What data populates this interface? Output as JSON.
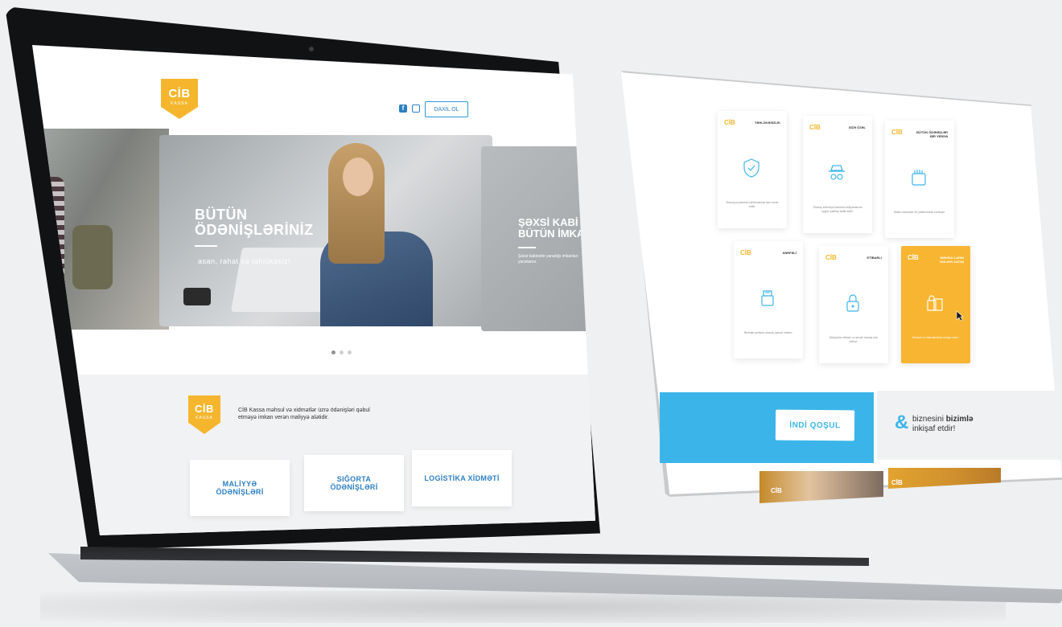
{
  "brand": {
    "logo_main": "CİB",
    "logo_sub": "KASSA",
    "accent": "#f5b62e",
    "primary": "#2d7fc1",
    "cyan": "#3bb5e9"
  },
  "header": {
    "login_label": "DAXİL OL",
    "social_icons": [
      "facebook-icon",
      "instagram-icon"
    ]
  },
  "hero": {
    "slides": [
      {
        "title": "BÜTÜN ÖDƏNİŞLƏRİNİZ",
        "subtitle": "asan, rahat və təhlükəsiz!"
      },
      {
        "title": "ŞƏXSİ KABİ BÜTÜN İMKA",
        "subtitle": "Şəxsi kabinetin yaradığı imkanları yararlanın."
      }
    ],
    "active_slide": 1,
    "slide_count": 3
  },
  "about": {
    "text": "CİB Kassa məhsul və xidmətlər üzrə ödənişləri qəbul etməyə imkan verən maliyyə alətidir."
  },
  "services": [
    "MALİYYƏ ÖDƏNİŞLƏRİ",
    "SIĞORTA ÖDƏNİŞLƏRİ",
    "LOGİSTİKA XİDMƏTİ"
  ],
  "features": [
    {
      "title": "TƏHLÜKƏSİZLİK",
      "icon": "shield-check-icon",
      "text": "Ödəniş prosesinin təhlükəsizliyi tam təmin edilir."
    },
    {
      "title": "SİZƏ ÖZƏL",
      "icon": "incognito-icon",
      "text": "Ödəniş interfeysi biznesin ehtiyaclarına uyğun şəkildə tərtib edilir."
    },
    {
      "title": "BÜTÜN ÖDƏNİŞLƏR BİR YERDƏ",
      "icon": "wallet-hand-icon",
      "text": "Bütün ödənişlər bir platformada cəmləşir."
    },
    {
      "title": "SƏRFƏLİ",
      "icon": "money-wallet-icon",
      "text": "Əlverişli şərtlərlə ödəniş qəbulu imkanı."
    },
    {
      "title": "ETİBARLI",
      "icon": "padlock-icon",
      "text": "Müştərilər etibarlı və sürətli ödəniş edə bilirlər."
    },
    {
      "title": "MƏHSULLARIN ONLAYN SATIŞI",
      "icon": "shopping-bags-icon",
      "text": "Məhsul və xidmətlərinizi onlayn satın."
    }
  ],
  "cta": {
    "join_label": "İNDİ QOŞUL",
    "grow_prefix": "biznesini ",
    "grow_bold": "bizimlə",
    "grow_suffix": "inkişaf etdir!"
  }
}
